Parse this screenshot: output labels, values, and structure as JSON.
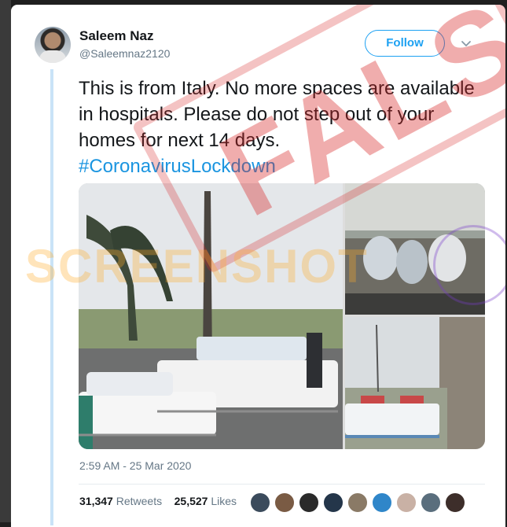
{
  "tweet": {
    "author_name": "Saleem Naz",
    "author_handle": "@Saleemnaz2120",
    "follow_label": "Follow",
    "text": "This is from Italy. No more spaces are available in hospitals.  Please do not step out of your homes for next 14 days.",
    "hashtag": "#CoronavirusLockdown",
    "timestamp": "2:59 AM - 25 Mar 2020",
    "retweets_count": "31,347",
    "retweets_label": "Retweets",
    "likes_count": "25,527",
    "likes_label": "Likes"
  },
  "overlays": {
    "watermark_main": "FALSE",
    "watermark_secondary": "SCREENSHOT"
  },
  "colors": {
    "accent": "#1da1f2",
    "hashtag": "#1b95e0",
    "watermark_red": "#d72828"
  },
  "icons": [
    "avatar",
    "chevron-down-icon"
  ]
}
